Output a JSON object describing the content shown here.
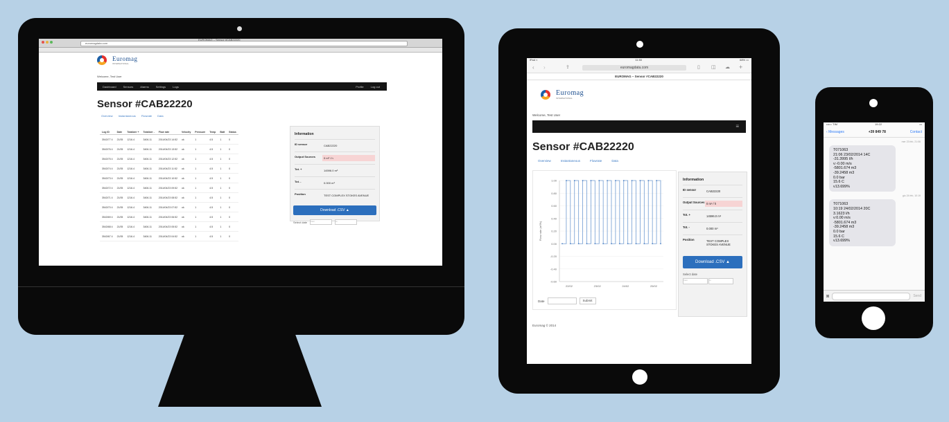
{
  "brand": {
    "name": "Euromag",
    "tagline": "INTERNATIONAL"
  },
  "desktop": {
    "browser_title": "EUROMAG – Sensor #CAB22220",
    "url": "euromagdata.com",
    "welcome": "Welcome, Test User",
    "nav": [
      "Dashboard",
      "Sensors",
      "Alarms",
      "Settings",
      "Logs"
    ],
    "nav_right": [
      "Profile",
      "Log out"
    ],
    "title": "Sensor #CAB22220",
    "tabs": [
      "Overview",
      "Instantaneous",
      "Flowrate",
      "Data"
    ],
    "table": {
      "headers": [
        "Log ID",
        "Date",
        "Totalizer +",
        "Totalizer -",
        "Flow rate",
        "Velocity",
        "Pressure",
        "Temp",
        "Batt",
        "Status"
      ],
      "rows": [
        [
          "3543/77 4",
          "21/05",
          "1216.4",
          "3406.11",
          "2014/04/23 14:52",
          "ok",
          "1",
          "4.5",
          "1",
          "0"
        ],
        [
          "3543/76 4",
          "21/05",
          "1216.4",
          "3406.11",
          "2014/04/23 13:52",
          "ok",
          "1",
          "4.5",
          "1",
          "0"
        ],
        [
          "3543/75 4",
          "21/05",
          "1216.4",
          "3406.11",
          "2014/04/23 12:52",
          "ok",
          "1",
          "4.5",
          "1",
          "0"
        ],
        [
          "3543/74 4",
          "21/05",
          "1216.4",
          "3406.11",
          "2014/04/23 11:52",
          "ok",
          "1",
          "4.5",
          "1",
          "0"
        ],
        [
          "3543/73 4",
          "21/05",
          "1216.4",
          "3406.11",
          "2014/04/23 10:52",
          "ok",
          "1",
          "4.5",
          "1",
          "0"
        ],
        [
          "3543/72 4",
          "21/05",
          "1216.4",
          "3406.11",
          "2014/04/23 09:52",
          "ok",
          "1",
          "4.5",
          "1",
          "0"
        ],
        [
          "3543/71 4",
          "21/05",
          "1216.4",
          "3406.11",
          "2014/04/23 08:52",
          "ok",
          "1",
          "4.5",
          "1",
          "0"
        ],
        [
          "3543/70 4",
          "21/05",
          "1216.4",
          "3406.11",
          "2014/04/23 07:52",
          "ok",
          "1",
          "4.5",
          "1",
          "0"
        ],
        [
          "3543/69 4",
          "21/05",
          "1216.4",
          "3406.11",
          "2014/04/23 06:52",
          "ok",
          "1",
          "4.5",
          "1",
          "0"
        ],
        [
          "3543/68 4",
          "21/05",
          "1216.4",
          "3406.11",
          "2014/04/23 05:52",
          "ok",
          "1",
          "4.5",
          "1",
          "0"
        ],
        [
          "3543/67 4",
          "21/05",
          "1216.4",
          "3406.11",
          "2014/04/23 04:52",
          "ok",
          "1",
          "4.5",
          "1",
          "0"
        ]
      ]
    },
    "info": {
      "title": "Information",
      "rows": [
        {
          "k": "ID sensor",
          "v": "CAB22220"
        },
        {
          "k": "Output Sources",
          "v": "0 m³ / h"
        },
        {
          "k": "Tot. +",
          "v": "14596.0 m³"
        },
        {
          "k": "Tot. -",
          "v": "0.000 m³"
        },
        {
          "k": "Position",
          "v": "TEST COMPLEX STOKES AVENUE"
        }
      ],
      "download": "Download .CSV ▲",
      "select_label": "Select date",
      "select_from": "from",
      "select_to": "to"
    }
  },
  "tablet": {
    "status_left": "iPad ≈",
    "status_center": "11:50",
    "status_right": "68% ▭",
    "url": "euromagdata.com",
    "page_title": "EUROMAG – Sensor #CAB22220",
    "welcome": "Welcome, Test User",
    "title": "Sensor #CAB22220",
    "tabs": [
      "Overview",
      "Instantaneous",
      "Flowrate",
      "Data"
    ],
    "chart_ylabel": "Flow rate (m³/h)",
    "date_label": "Date",
    "submit": "Submit",
    "footer": "Euromag © 2014",
    "info": {
      "title": "Information",
      "rows": [
        {
          "k": "ID sensor",
          "v": "CAB22220"
        },
        {
          "k": "Output Sources",
          "v": "0 m³ / h"
        },
        {
          "k": "Tot. +",
          "v": "14596.0 m³"
        },
        {
          "k": "Tot. -",
          "v": "0.000 m³"
        },
        {
          "k": "Position",
          "v": "TEST COMPLEX STOKES AVENUE"
        }
      ],
      "download": "Download .CSV ▲",
      "select_label": "Select date",
      "select_from": "from",
      "select_to": "to"
    }
  },
  "chart_data": {
    "type": "line",
    "title": "",
    "xlabel": "",
    "ylabel": "Flow rate (m³/h)",
    "y_ticks": [
      "1.00",
      "0.80",
      "0.60",
      "0.40",
      "0.20",
      "0.00",
      "-0.20",
      "-0.40",
      "-0.60"
    ],
    "x_ticks": [
      "22/02",
      "23/02",
      "24/02",
      "25/02"
    ],
    "ylim": [
      -0.6,
      1.0
    ],
    "series": [
      {
        "values": [
          0,
          1,
          0,
          1,
          0,
          1,
          0,
          1,
          0,
          1,
          0,
          1,
          0,
          1,
          0,
          1,
          0,
          1,
          0,
          1,
          0,
          1,
          0,
          1,
          0
        ]
      }
    ]
  },
  "phone": {
    "status_left": "••••○ TIM",
    "status_center": "19:22",
    "status_right": "▭",
    "back": "Messages",
    "contact": "+39 849 78",
    "action": "Contact",
    "messages": [
      {
        "time": "mer 23 feb, 21:06",
        "text": "T071063\n21:06 23/02/2014 14C\n-31.3995 l/h\nv:-0.00 m/s\n-5801.674 m3\n-39.2458 m3\n0.0 bar\n15.6 C\nv13.699%"
      },
      {
        "time": "gio 24 feb, 10:19",
        "text": "T071063\n10:19 24/02/2014 20C\n3.1623 l/h\nv:0.00 m/s\n-5801.674 m3\n-39.2458 m3\n0.0 bar\n15.6 C\nv13.699%"
      }
    ],
    "send": "Send"
  }
}
